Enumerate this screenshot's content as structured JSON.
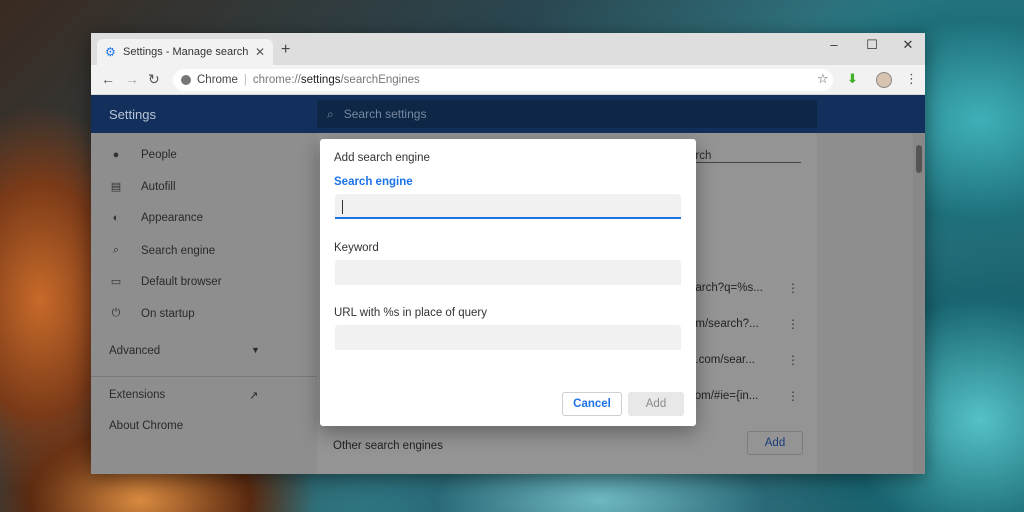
{
  "tab": {
    "title": "Settings - Manage search engines"
  },
  "toolbar": {
    "omnibox_label": "Chrome",
    "url_prefix": "chrome://",
    "url_path": "settings",
    "url_suffix": "/searchEngines"
  },
  "settings": {
    "title": "Settings",
    "search_placeholder": "Search settings"
  },
  "sidebar": {
    "items": [
      {
        "label": "People",
        "icon": "person-icon"
      },
      {
        "label": "Autofill",
        "icon": "clipboard-icon"
      },
      {
        "label": "Appearance",
        "icon": "palette-icon"
      },
      {
        "label": "Search engine",
        "icon": "search-icon"
      },
      {
        "label": "Default browser",
        "icon": "browser-icon"
      },
      {
        "label": "On startup",
        "icon": "power-icon"
      }
    ],
    "advanced": "Advanced",
    "extensions": "Extensions",
    "about": "About Chrome"
  },
  "main": {
    "search_fragment": "arch",
    "rows": [
      "earch?q=%s...",
      "om/search?...",
      "o.com/sear...",
      "com/#ie={in..."
    ],
    "other_engines": "Other search engines",
    "add_label": "Add"
  },
  "dialog": {
    "title": "Add search engine",
    "engine_label": "Search engine",
    "keyword_label": "Keyword",
    "url_label": "URL with %s in place of query",
    "cancel_label": "Cancel",
    "add_label": "Add"
  }
}
